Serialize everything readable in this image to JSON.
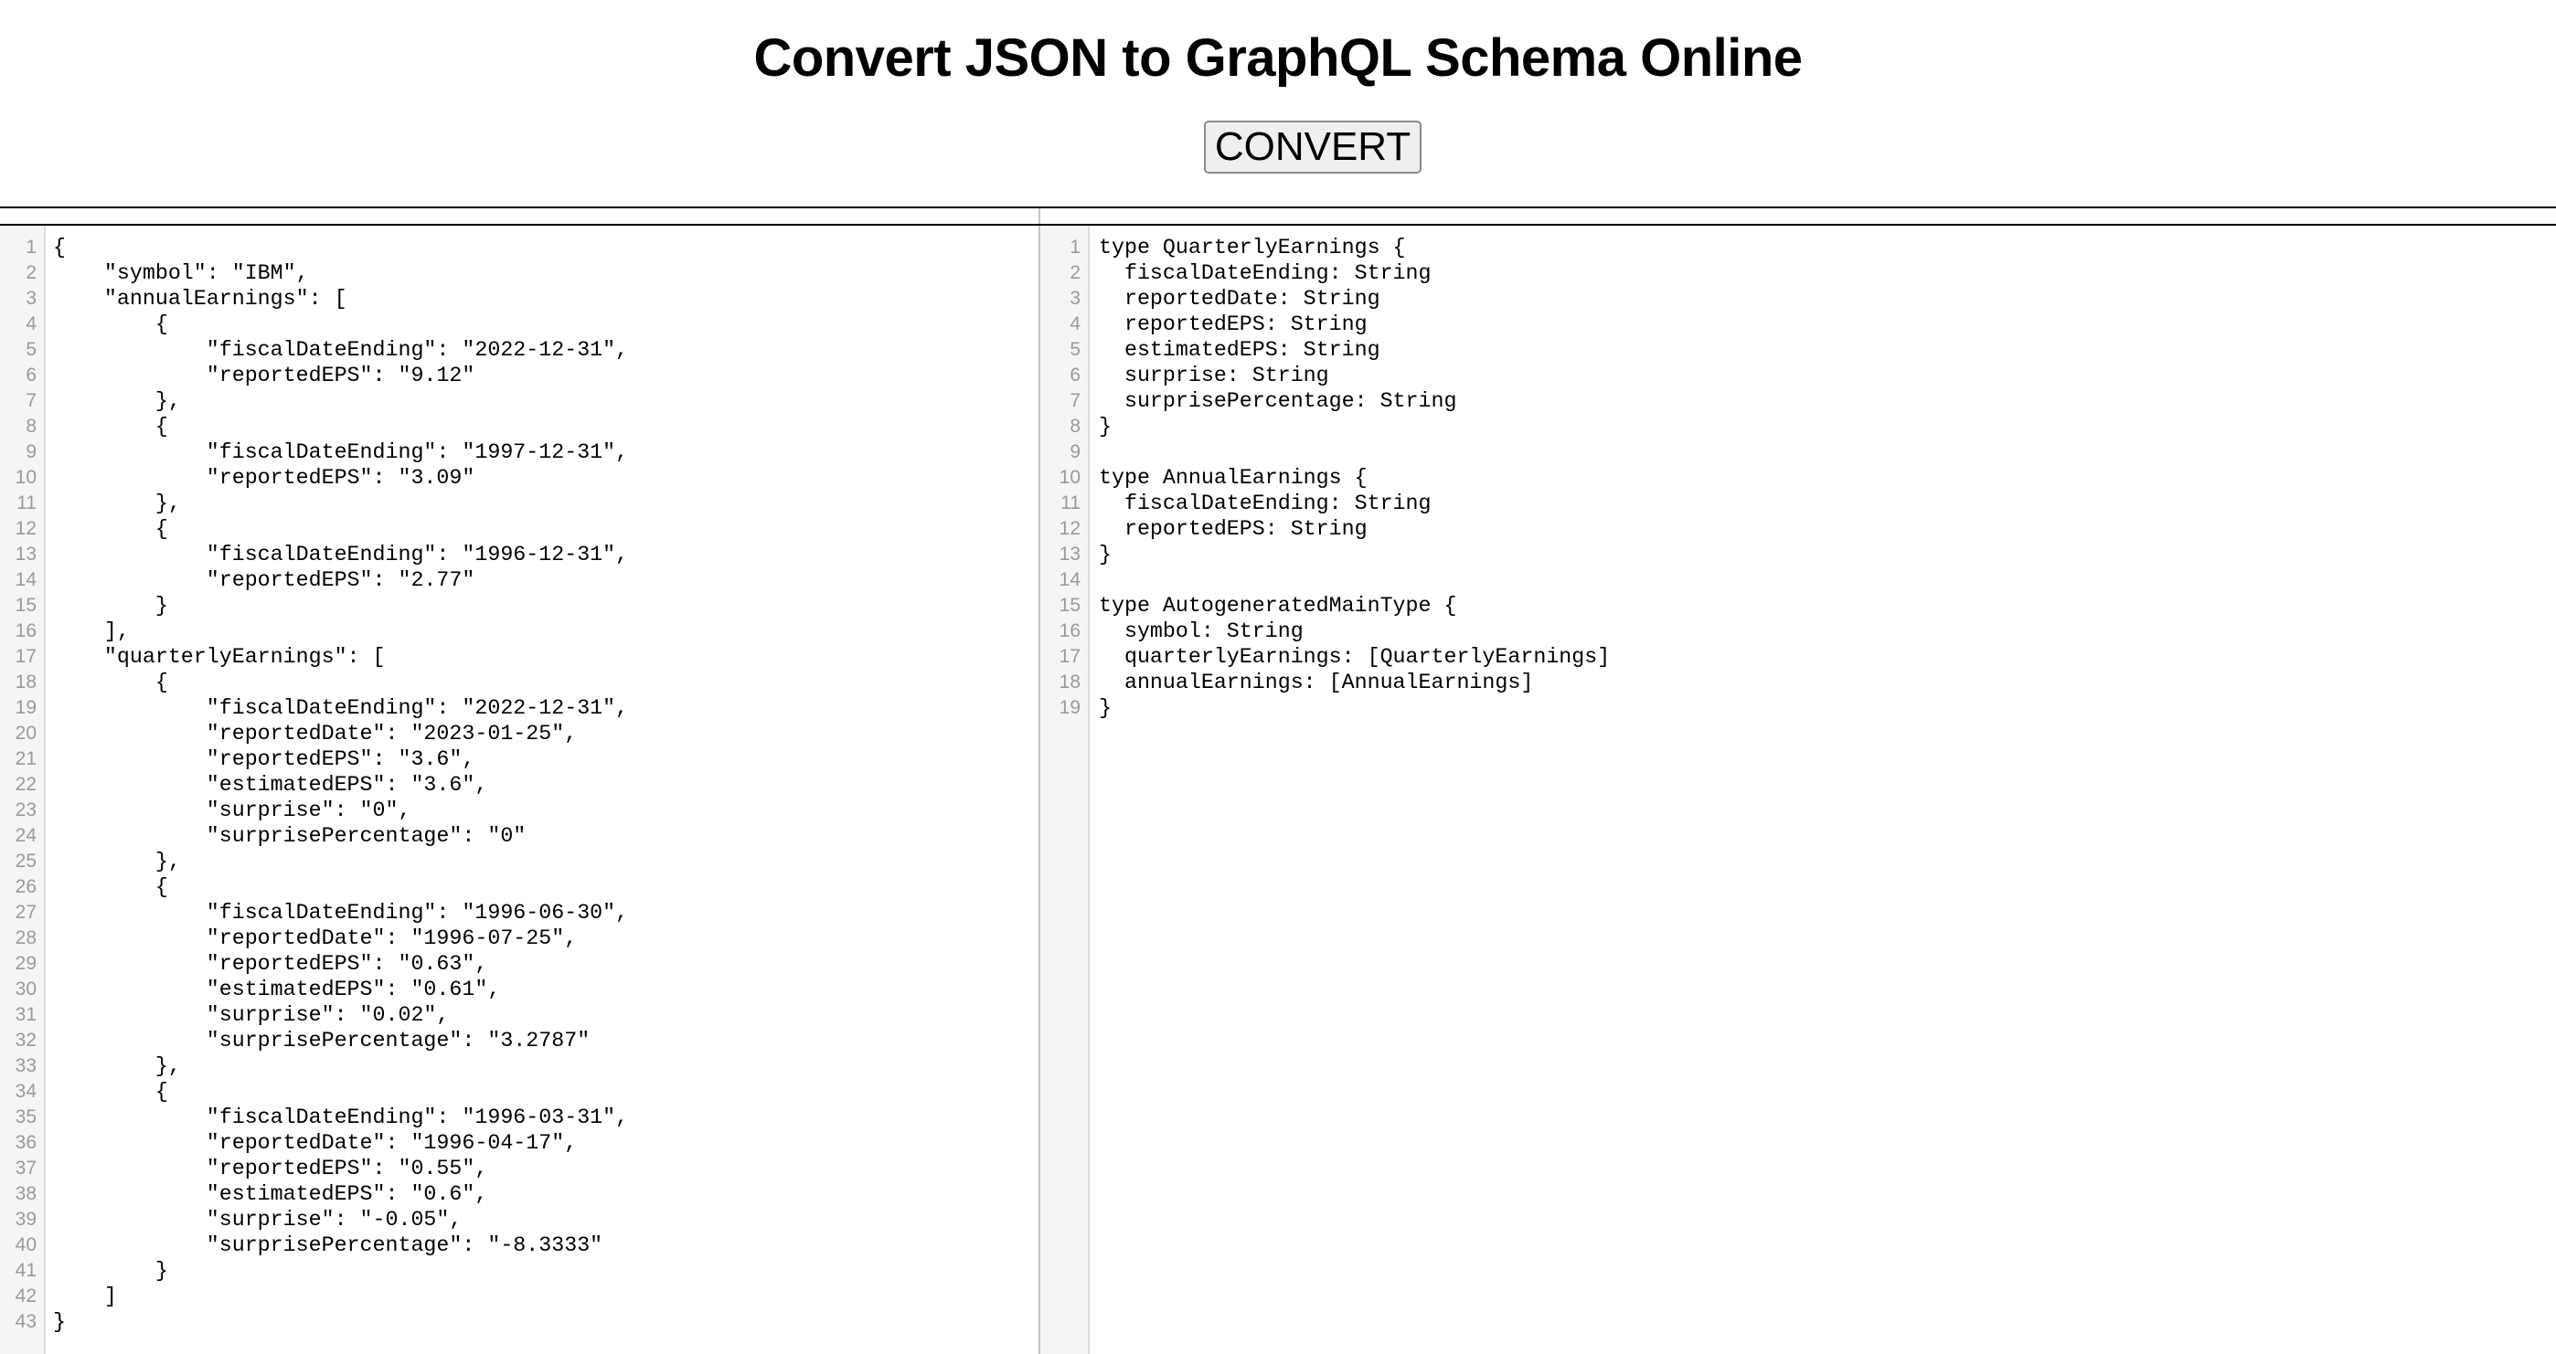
{
  "page": {
    "title": "Convert JSON to GraphQL Schema Online",
    "convert_button": "CONVERT"
  },
  "input_editor": {
    "lines": [
      "{",
      "    \"symbol\": \"IBM\",",
      "    \"annualEarnings\": [",
      "        {",
      "            \"fiscalDateEnding\": \"2022-12-31\",",
      "            \"reportedEPS\": \"9.12\"",
      "        },",
      "        {",
      "            \"fiscalDateEnding\": \"1997-12-31\",",
      "            \"reportedEPS\": \"3.09\"",
      "        },",
      "        {",
      "            \"fiscalDateEnding\": \"1996-12-31\",",
      "            \"reportedEPS\": \"2.77\"",
      "        }",
      "    ],",
      "    \"quarterlyEarnings\": [",
      "        {",
      "            \"fiscalDateEnding\": \"2022-12-31\",",
      "            \"reportedDate\": \"2023-01-25\",",
      "            \"reportedEPS\": \"3.6\",",
      "            \"estimatedEPS\": \"3.6\",",
      "            \"surprise\": \"0\",",
      "            \"surprisePercentage\": \"0\"",
      "        },",
      "        {",
      "            \"fiscalDateEnding\": \"1996-06-30\",",
      "            \"reportedDate\": \"1996-07-25\",",
      "            \"reportedEPS\": \"0.63\",",
      "            \"estimatedEPS\": \"0.61\",",
      "            \"surprise\": \"0.02\",",
      "            \"surprisePercentage\": \"3.2787\"",
      "        },",
      "        {",
      "            \"fiscalDateEnding\": \"1996-03-31\",",
      "            \"reportedDate\": \"1996-04-17\",",
      "            \"reportedEPS\": \"0.55\",",
      "            \"estimatedEPS\": \"0.6\",",
      "            \"surprise\": \"-0.05\",",
      "            \"surprisePercentage\": \"-8.3333\"",
      "        }",
      "    ]",
      "}"
    ]
  },
  "output_editor": {
    "lines": [
      "type QuarterlyEarnings {",
      "  fiscalDateEnding: String",
      "  reportedDate: String",
      "  reportedEPS: String",
      "  estimatedEPS: String",
      "  surprise: String",
      "  surprisePercentage: String",
      "}",
      "",
      "type AnnualEarnings {",
      "  fiscalDateEnding: String",
      "  reportedEPS: String",
      "}",
      "",
      "type AutogeneratedMainType {",
      "  symbol: String",
      "  quarterlyEarnings: [QuarterlyEarnings]",
      "  annualEarnings: [AnnualEarnings]",
      "}"
    ]
  }
}
